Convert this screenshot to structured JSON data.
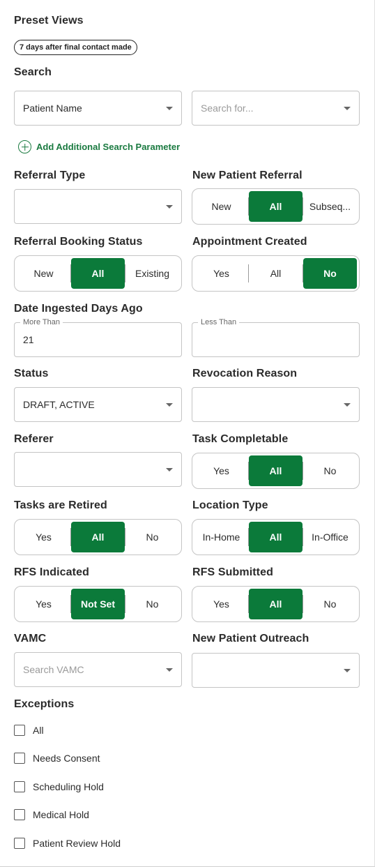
{
  "preset_views": {
    "label": "Preset Views",
    "chip": "7 days after final contact made"
  },
  "search": {
    "label": "Search",
    "field_value": "Patient Name",
    "search_placeholder": "Search for...",
    "add_parameter": "Add Additional Search Parameter"
  },
  "referral_type": {
    "label": "Referral Type",
    "value": ""
  },
  "new_patient_referral": {
    "label": "New Patient Referral",
    "options": [
      "New",
      "All",
      "Subseq..."
    ],
    "selected": "All"
  },
  "referral_booking_status": {
    "label": "Referral Booking Status",
    "options": [
      "New",
      "All",
      "Existing"
    ],
    "selected": "All"
  },
  "appointment_created": {
    "label": "Appointment Created",
    "options": [
      "Yes",
      "All",
      "No"
    ],
    "selected": "No"
  },
  "date_ingested": {
    "label": "Date Ingested Days Ago",
    "more_than_label": "More Than",
    "more_than_value": "21",
    "less_than_label": "Less Than",
    "less_than_value": ""
  },
  "status": {
    "label": "Status",
    "value": "DRAFT, ACTIVE"
  },
  "revocation_reason": {
    "label": "Revocation Reason",
    "value": ""
  },
  "referer": {
    "label": "Referer",
    "value": ""
  },
  "task_completable": {
    "label": "Task Completable",
    "options": [
      "Yes",
      "All",
      "No"
    ],
    "selected": "All"
  },
  "tasks_retired": {
    "label": "Tasks are Retired",
    "options": [
      "Yes",
      "All",
      "No"
    ],
    "selected": "All"
  },
  "location_type": {
    "label": "Location Type",
    "options": [
      "In-Home",
      "All",
      "In-Office"
    ],
    "selected": "All"
  },
  "rfs_indicated": {
    "label": "RFS Indicated",
    "options": [
      "Yes",
      "Not Set",
      "No"
    ],
    "selected": "Not Set"
  },
  "rfs_submitted": {
    "label": "RFS Submitted",
    "options": [
      "Yes",
      "All",
      "No"
    ],
    "selected": "All"
  },
  "vamc": {
    "label": "VAMC",
    "placeholder": "Search VAMC"
  },
  "new_patient_outreach": {
    "label": "New Patient Outreach",
    "value": ""
  },
  "exceptions": {
    "label": "Exceptions",
    "items": [
      "All",
      "Needs Consent",
      "Scheduling Hold",
      "Medical Hold",
      "Patient Review Hold"
    ]
  },
  "colors": {
    "accent": "#0b7a3a",
    "link": "#1a7a40",
    "border": "#c4c4c4"
  },
  "icons": [
    "chevron-down-icon",
    "plus-circle-icon",
    "checkbox-icon"
  ]
}
